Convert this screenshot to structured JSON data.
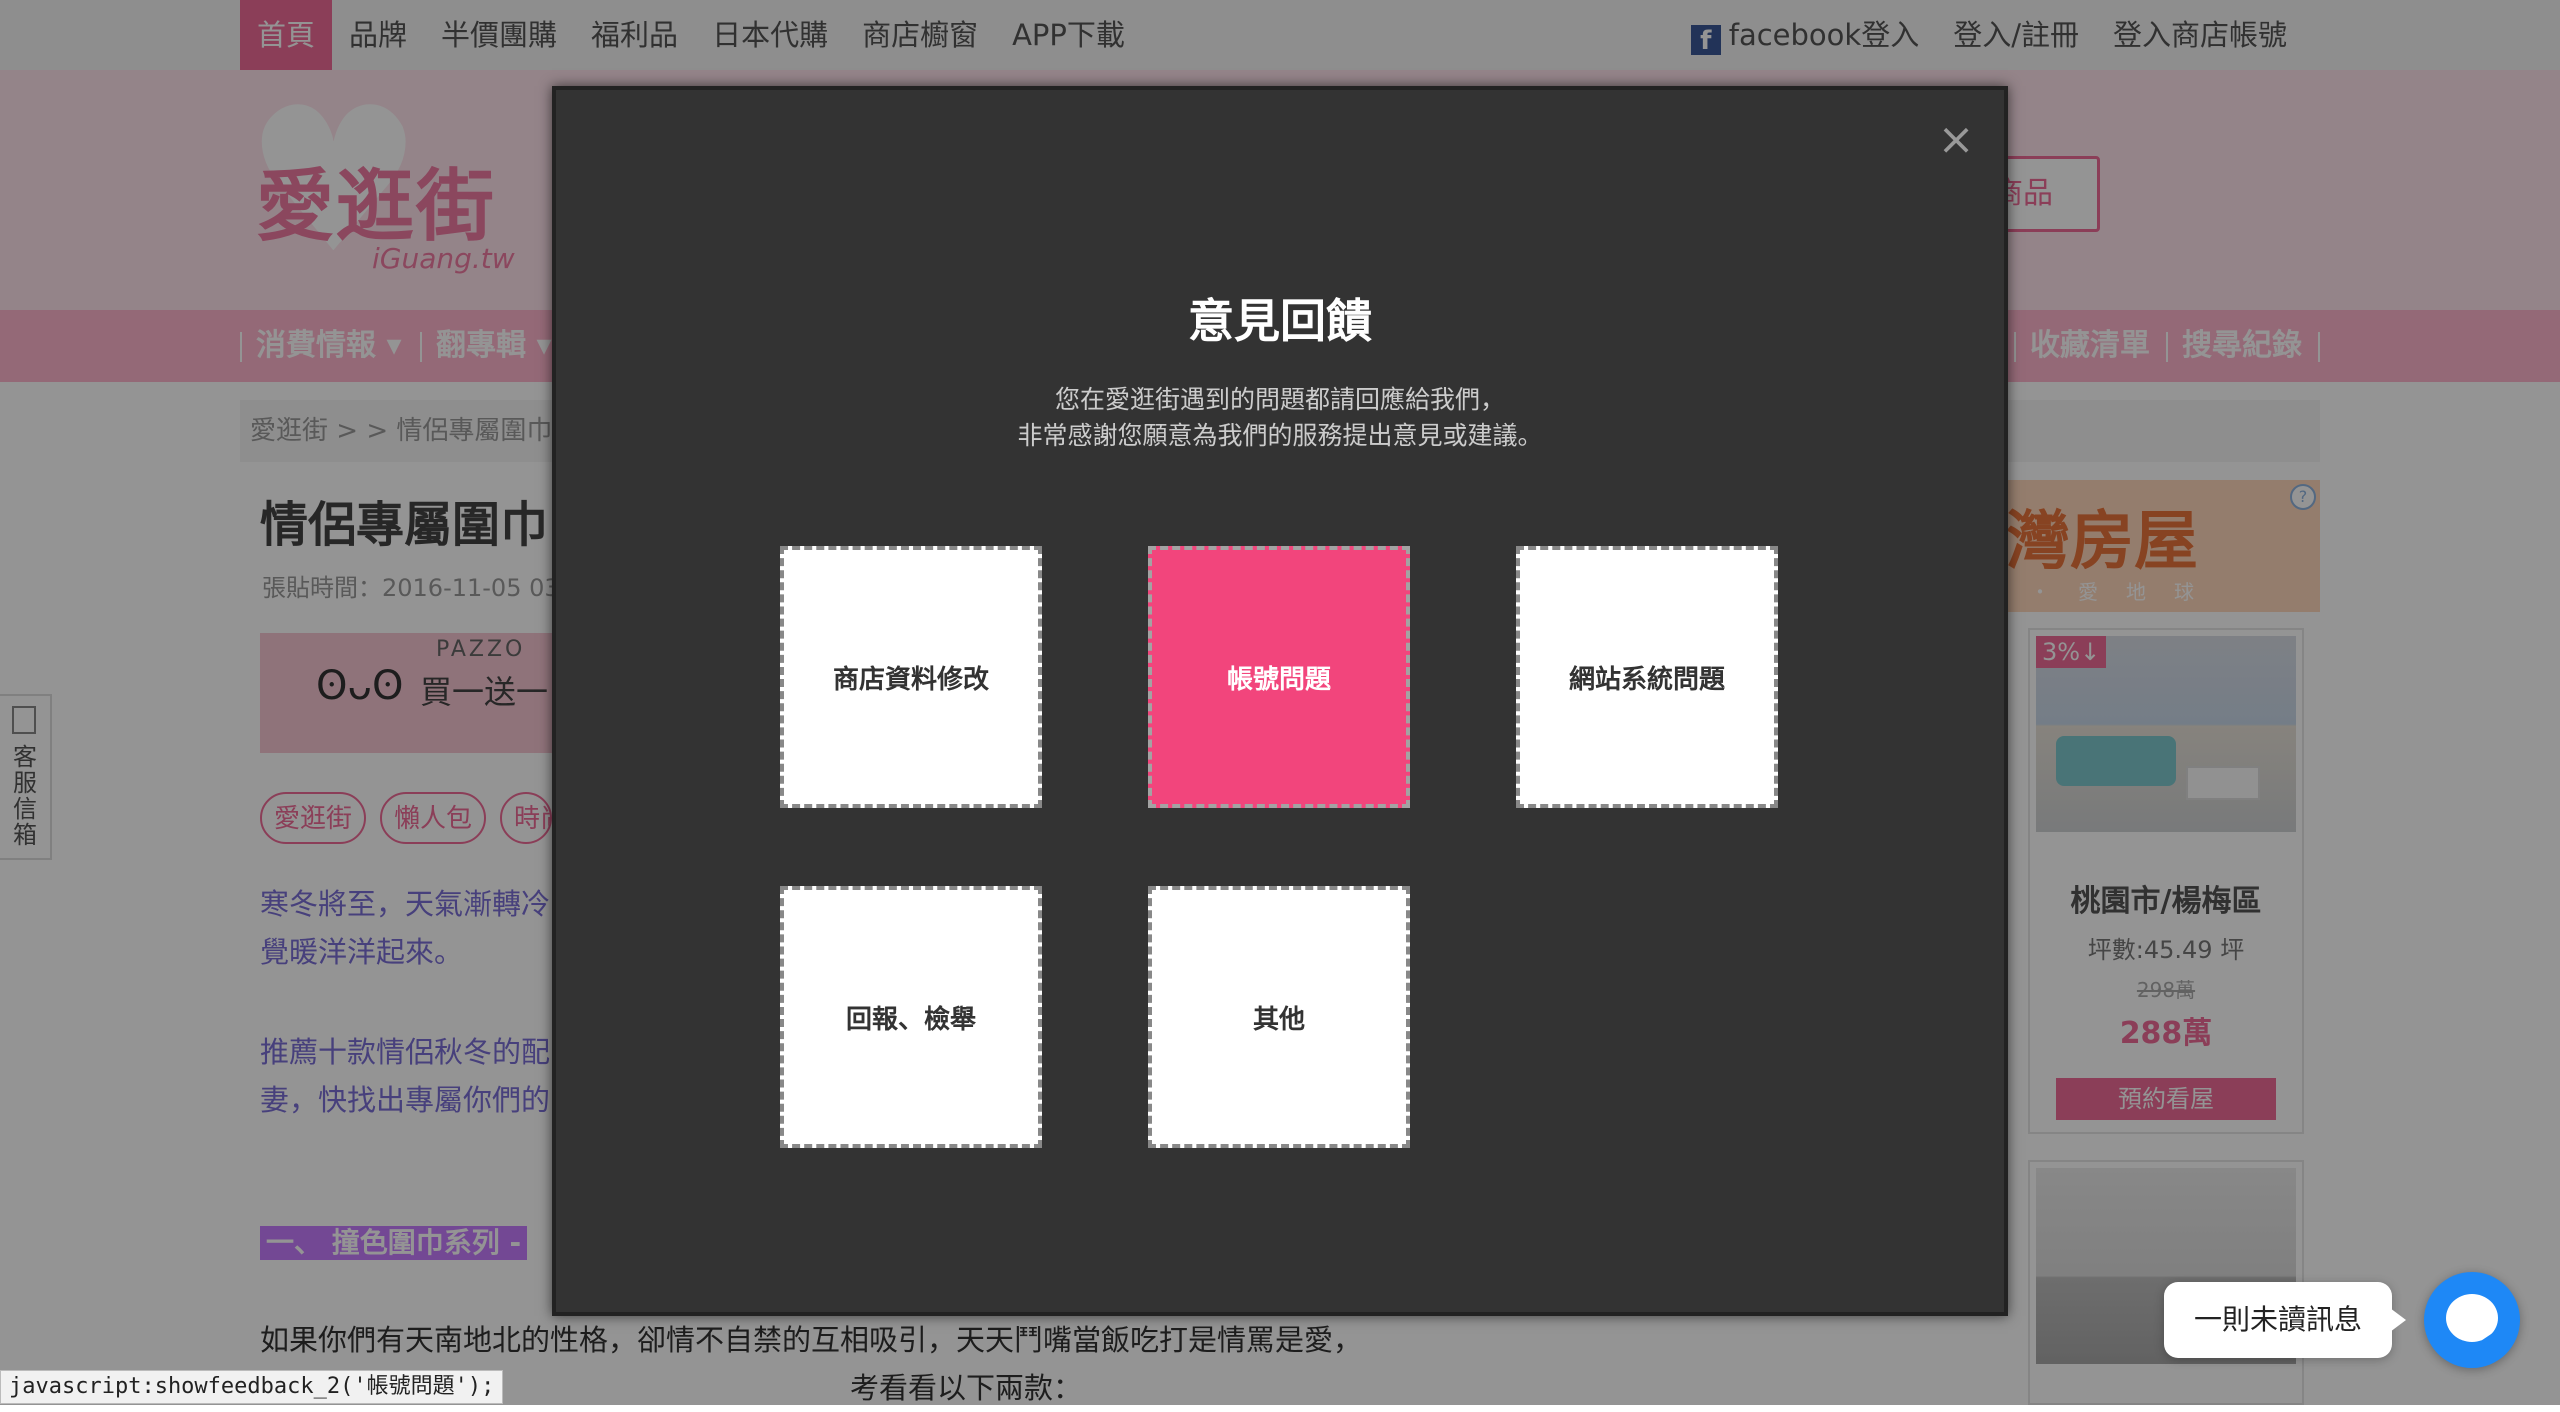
{
  "topnav": {
    "left": [
      "首頁",
      "品牌",
      "半價團購",
      "福利品",
      "日本代購",
      "商店櫥窗",
      "APP下載"
    ],
    "facebook_login": "facebook登入",
    "login_register": "登入/註冊",
    "shop_login": "登入商店帳號"
  },
  "logo": {
    "name": "愛逛街",
    "sub": "iGuang.tw"
  },
  "header_button": "商品",
  "catnav": {
    "left": [
      "消費情報",
      "翻專輯"
    ],
    "right": [
      "收藏清單",
      "搜尋紀錄"
    ]
  },
  "breadcrumb": "愛逛街 > > 情侶專屬圍巾",
  "article": {
    "title": "情侶專屬圍巾",
    "time": "張貼時間：2016-11-05 03:",
    "banner": {
      "brand": "PAZZO",
      "promo": "買一送一"
    },
    "tags": [
      "愛逛街",
      "懶人包",
      "時尚"
    ],
    "para1": [
      "寒冬將至，天氣漸轉冷",
      "覺暖洋洋起來。"
    ],
    "para2": [
      "推薦十款情侶秋冬的配",
      "妻，快找出專屬你們的"
    ],
    "section_heading": "一、 撞色圍巾系列 -",
    "para3": [
      "如果你們有天南地北的性格，卻情不自禁的互相吸引，天天鬥嘴當飯吃打是情罵是愛，",
      "考看看以下兩款："
    ]
  },
  "side_mailbox": {
    "label": "客服信箱"
  },
  "ad": {
    "header_big": "灣房屋",
    "header_small": "・愛地球",
    "question": "?",
    "badge": "3%↓",
    "location": "桃園市/楊梅區",
    "area": "坪數:45.49 坪",
    "old_price": "298萬",
    "price": "288萬",
    "cta": "預約看屋"
  },
  "modal": {
    "close": "×",
    "title": "意見回饋",
    "desc_line1": "您在愛逛街遇到的問題都請回應給我們，",
    "desc_line2": "非常感謝您願意為我們的服務提出意見或建議。",
    "options": [
      "商店資料修改",
      "帳號問題",
      "網站系統問題",
      "回報、檢舉",
      "其他"
    ],
    "selected_option": "帳號問題"
  },
  "status_bar": "javascript:showfeedback_2('帳號問題');",
  "messenger": {
    "bubble": "一則未讀訊息"
  },
  "colors": {
    "accent": "#f2457c",
    "modal_bg": "#333333",
    "pink_header": "#ffe3ec",
    "pink_nav": "#ffb6cd"
  }
}
